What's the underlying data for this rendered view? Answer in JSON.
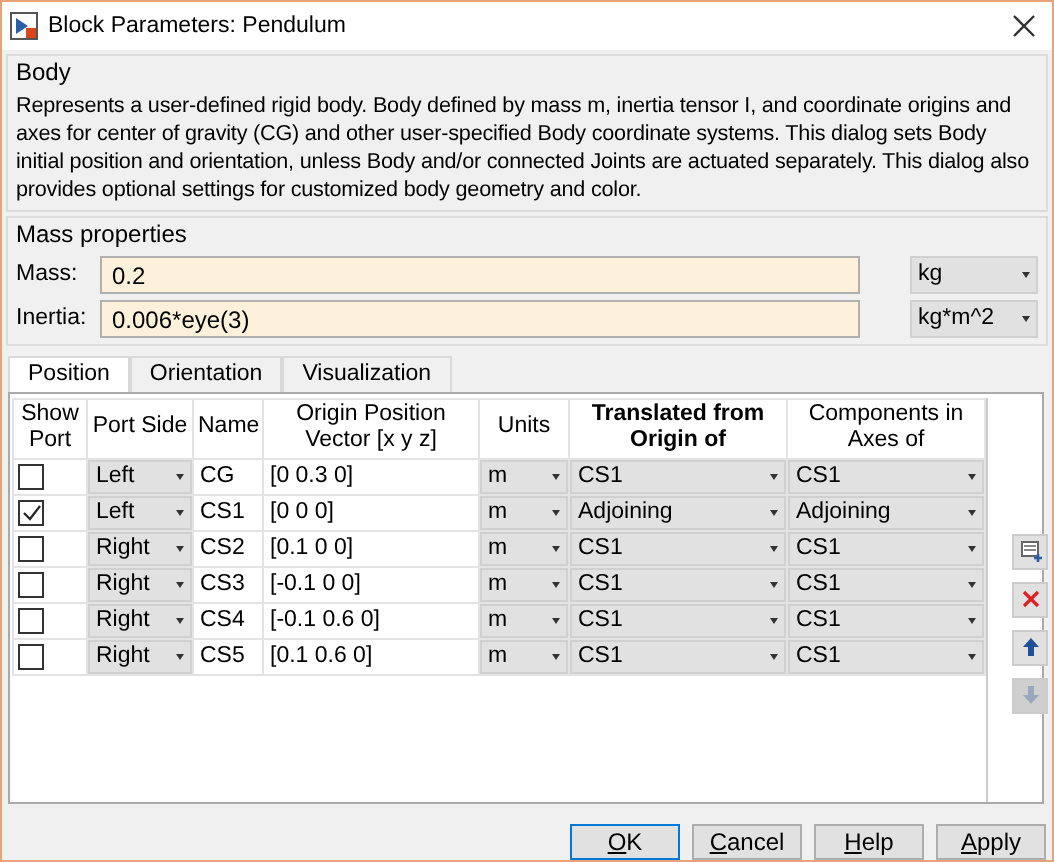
{
  "window": {
    "title": "Block Parameters: Pendulum"
  },
  "body_section": {
    "title": "Body",
    "description": "Represents a user-defined rigid body. Body defined by mass m, inertia tensor I, and coordinate origins and axes for center of gravity (CG) and other user-specified Body coordinate systems. This dialog sets Body initial position and orientation, unless Body and/or connected Joints are actuated separately. This dialog also provides optional settings for customized body geometry and color."
  },
  "mass_properties": {
    "title": "Mass properties",
    "fields": [
      {
        "label": "Mass:",
        "value": "0.2",
        "unit": "kg"
      },
      {
        "label": "Inertia:",
        "value": "0.006*eye(3)",
        "unit": "kg*m^2"
      }
    ]
  },
  "tabs": [
    {
      "label": "Position",
      "selected": true
    },
    {
      "label": "Orientation",
      "selected": false
    },
    {
      "label": "Visualization",
      "selected": false
    }
  ],
  "table": {
    "columns": [
      {
        "label": "Show Port",
        "bold": false
      },
      {
        "label": "Port Side",
        "bold": false
      },
      {
        "label": "Name",
        "bold": false
      },
      {
        "label": "Origin Position Vector [x y z]",
        "bold": false
      },
      {
        "label": "Units",
        "bold": false
      },
      {
        "label": "Translated from Origin of",
        "bold": true
      },
      {
        "label": "Components in Axes of",
        "bold": false
      }
    ],
    "rows": [
      {
        "show_port": false,
        "port_side": "Left",
        "name": "CG",
        "origin": "[0 0.3 0]",
        "units": "m",
        "translated_from": "CS1",
        "components_in": "CS1"
      },
      {
        "show_port": true,
        "port_side": "Left",
        "name": "CS1",
        "origin": "[0 0 0]",
        "units": "m",
        "translated_from": "Adjoining",
        "components_in": "Adjoining"
      },
      {
        "show_port": false,
        "port_side": "Right",
        "name": "CS2",
        "origin": "[0.1 0 0]",
        "units": "m",
        "translated_from": "CS1",
        "components_in": "CS1"
      },
      {
        "show_port": false,
        "port_side": "Right",
        "name": "CS3",
        "origin": "[-0.1 0 0]",
        "units": "m",
        "translated_from": "CS1",
        "components_in": "CS1"
      },
      {
        "show_port": false,
        "port_side": "Right",
        "name": "CS4",
        "origin": "[-0.1 0.6 0]",
        "units": "m",
        "translated_from": "CS1",
        "components_in": "CS1"
      },
      {
        "show_port": false,
        "port_side": "Right",
        "name": "CS5",
        "origin": "[0.1 0.6 0]",
        "units": "m",
        "translated_from": "CS1",
        "components_in": "CS1"
      }
    ]
  },
  "side_buttons": [
    {
      "kind": "add",
      "disabled": false
    },
    {
      "kind": "delete",
      "disabled": false
    },
    {
      "kind": "up",
      "disabled": false
    },
    {
      "kind": "down",
      "disabled": true
    }
  ],
  "buttons": [
    {
      "mnemonic": "O",
      "label_rest": "K",
      "default": true
    },
    {
      "mnemonic": "C",
      "label_rest": "ancel",
      "default": false
    },
    {
      "mnemonic": "H",
      "label_rest": "elp",
      "default": false
    },
    {
      "mnemonic": "A",
      "label_rest": "pply",
      "default": false
    }
  ]
}
